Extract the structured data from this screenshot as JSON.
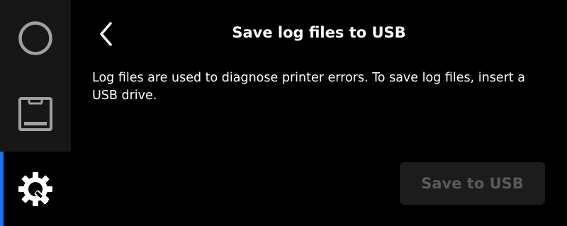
{
  "sidebar": {
    "items": [
      {
        "id": "print",
        "icon": "circle-icon",
        "state": "inactive"
      },
      {
        "id": "material",
        "icon": "material-box-icon",
        "state": "inactive"
      },
      {
        "id": "settings",
        "icon": "settings-wrench-icon",
        "state": "active"
      }
    ],
    "active_color": "#1a73e8"
  },
  "header": {
    "back_icon": "chevron-left-icon",
    "title": "Save log files to USB"
  },
  "main": {
    "description": "Log files are used to diagnose printer errors. To save log files, insert a USB drive.",
    "save_button_label": "Save to USB",
    "save_button_state": "disabled"
  }
}
